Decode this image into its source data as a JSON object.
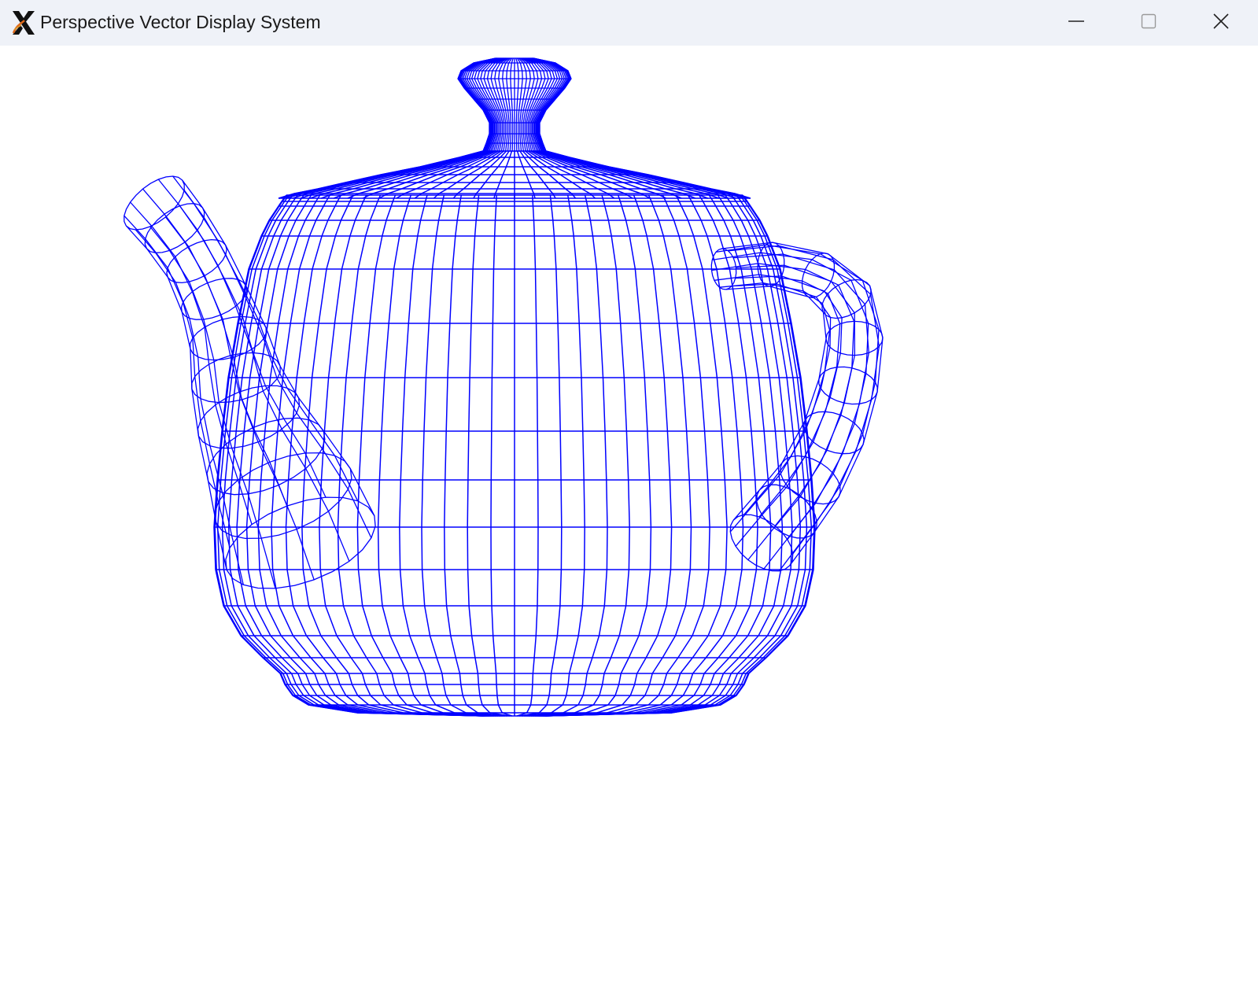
{
  "window": {
    "title": "Perspective Vector Display System",
    "app_icon": "x-window-system-icon",
    "controls": {
      "minimize_icon": "minimize-icon",
      "maximize_icon": "maximize-icon",
      "close_icon": "close-icon"
    }
  },
  "canvas": {
    "background": "#ffffff",
    "line_color": "#0000ff",
    "subject": "wireframe-teapot"
  }
}
